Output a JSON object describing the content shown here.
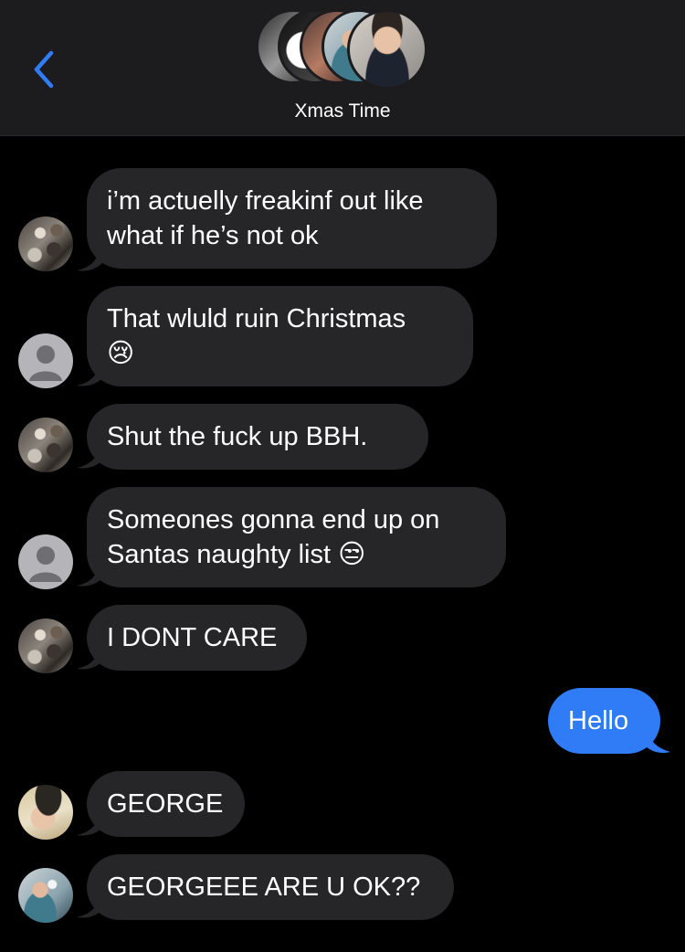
{
  "header": {
    "title": "Xmas Time",
    "back_icon": "chevron-left-icon",
    "accent_color": "#2f7cf6"
  },
  "messages": [
    {
      "sender_avatar": "cat-photo",
      "text": "i’m actuelly freakinf out like\nwhat if he’s not ok"
    },
    {
      "sender_avatar": "default-person",
      "text": "That wluld ruin Christmas\n😢"
    },
    {
      "sender_avatar": "cat-photo",
      "text": "Shut the fuck up BBH."
    },
    {
      "sender_avatar": "default-person",
      "text": "Someones gonna end up on\nSantas naughty list 😒"
    },
    {
      "sender_avatar": "cat-photo",
      "text": "I DONT CARE"
    },
    {
      "sender_avatar": "me",
      "text": "Hello"
    },
    {
      "sender_avatar": "hat-photo",
      "text": "GEORGE"
    },
    {
      "sender_avatar": "mirror-selfie",
      "text": "GEORGEEE ARE U OK??"
    }
  ],
  "colors": {
    "incoming_bubble": "#262628",
    "outgoing_bubble": "#2f7cf6",
    "background": "#000000",
    "header": "#1c1c1e"
  }
}
